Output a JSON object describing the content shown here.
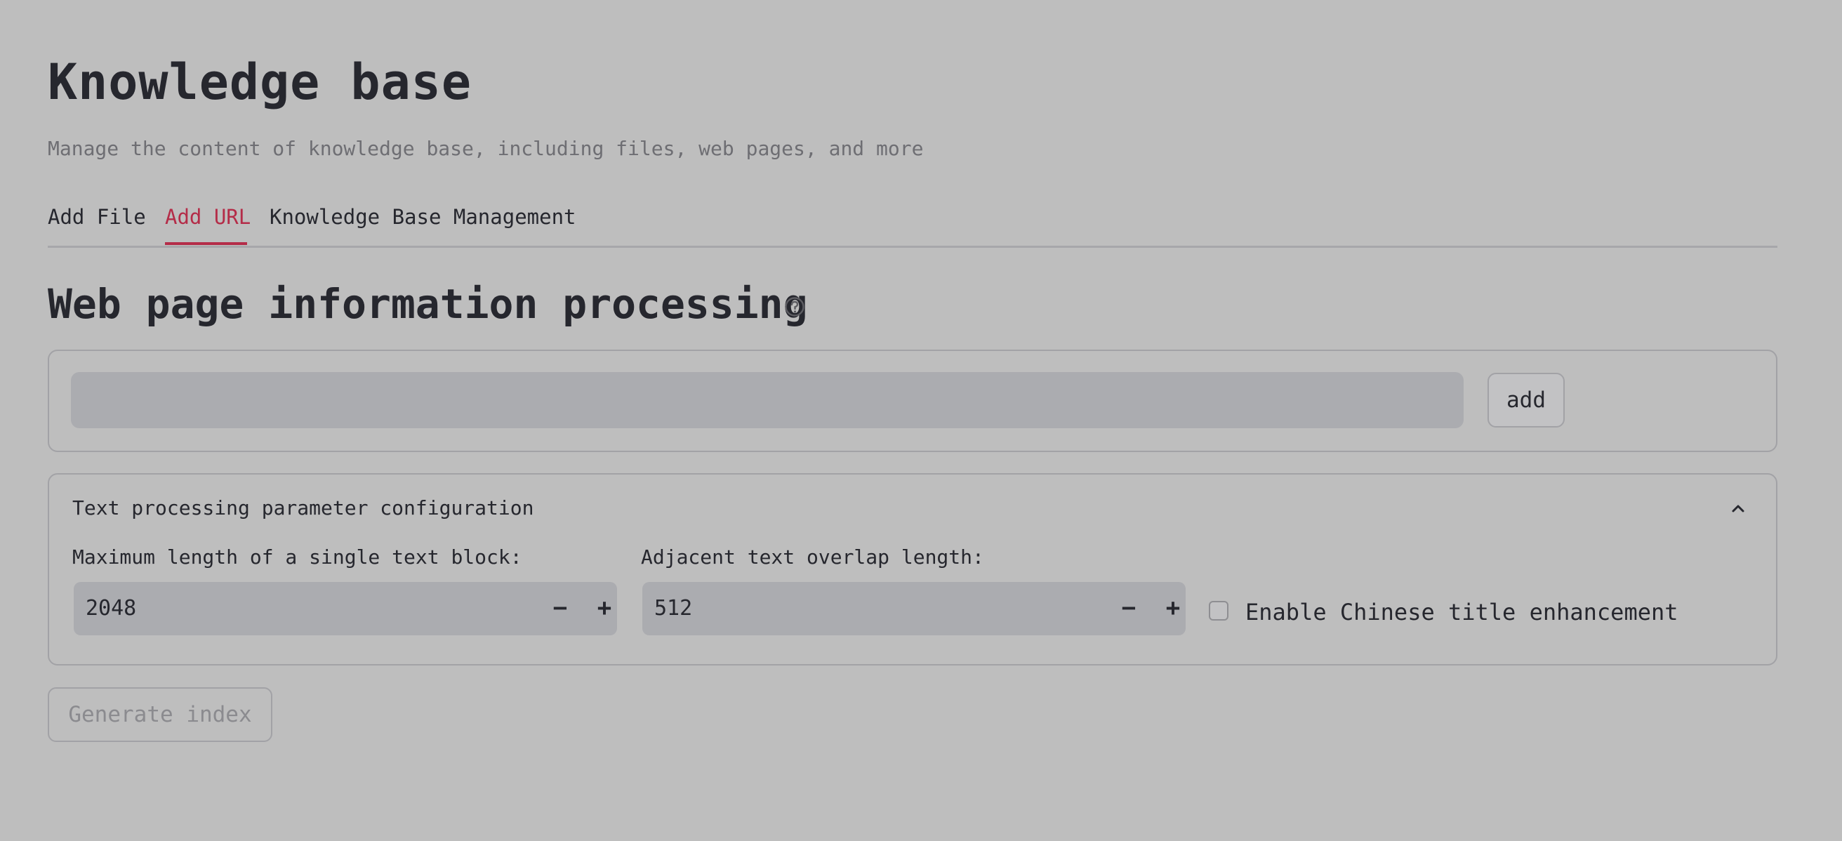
{
  "header": {
    "title": "Knowledge base",
    "subtitle": "Manage the content of knowledge base, including files, web pages, and more"
  },
  "tabs": [
    {
      "label": "Add File",
      "active": false
    },
    {
      "label": "Add URL",
      "active": true
    },
    {
      "label": "Knowledge Base Management",
      "active": false
    }
  ],
  "section": {
    "title": "Web page information processing",
    "help_icon": "question-circle-icon"
  },
  "url_form": {
    "input_value": "",
    "add_label": "add"
  },
  "config": {
    "header": "Text processing parameter configuration",
    "collapse_icon": "chevron-up-icon",
    "max_length": {
      "label": "Maximum length of a single text block:",
      "value": "2048"
    },
    "overlap": {
      "label": "Adjacent text overlap length:",
      "value": "512"
    },
    "stepper": {
      "decrement": "−",
      "increment": "+"
    },
    "chinese_title": {
      "label": "Enable Chinese title enhancement",
      "checked": false
    }
  },
  "actions": {
    "generate_label": "Generate index"
  },
  "colors": {
    "background": "#bebebe",
    "accent": "#b42c48",
    "text": "#26272e",
    "muted_text": "#6e6e73",
    "input_fill": "#abacb0"
  }
}
